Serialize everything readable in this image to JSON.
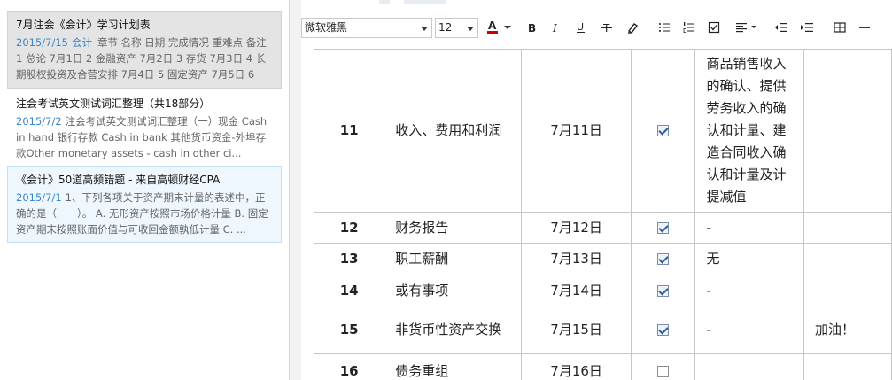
{
  "notes": [
    {
      "title": "7月注会《会计》学习计划表",
      "date": "2015/7/15",
      "tag": "会计",
      "snippet": "章节 名称 日期 完成情况 重难点 备注 1 总论 7月1日 2 金融资产 7月2日 3 存货 7月3日 4 长期股权投资及合营安排 7月4日 5 固定资产 7月5日 6"
    },
    {
      "title": "注会考试英文测试词汇整理（共18部分）",
      "date": "2015/7/2",
      "tag": "",
      "snippet": "注会考试英文测试词汇整理（一）现金 Cash in hand 银行存款 Cash in bank 其他货币资金-外埠存款Other monetary assets - cash in other ci..."
    },
    {
      "title": "《会计》50道高频错题 - 来自高顿财经CPA",
      "date": "2015/7/1",
      "tag": "",
      "snippet": "1、下列各项关于资产期末计量的表述中，正确的是（　　）。 A. 无形资产按照市场价格计量 B. 固定资产期末按照账面价值与可收回金额孰低计量 C. ..."
    }
  ],
  "toolbar": {
    "font_family": "微软雅黑",
    "font_size": "12",
    "buttons": [
      "font-color",
      "bold",
      "italic",
      "underline",
      "strikethrough",
      "highlight",
      "bulleted-list",
      "numbered-list",
      "checkbox",
      "align",
      "outdent",
      "indent",
      "table",
      "horizontal-rule"
    ],
    "font_color_accent": "#cc0000"
  },
  "table": {
    "rows": [
      {
        "num": "11",
        "name": "收入、费用和利润",
        "date": "7月11日",
        "checked": true,
        "key_points": "商品销售收入的确认、提供劳务收入的确认和计量、建造合同收入确认和计量及计提减值",
        "remark": ""
      },
      {
        "num": "12",
        "name": "财务报告",
        "date": "7月12日",
        "checked": true,
        "key_points": "-",
        "remark": ""
      },
      {
        "num": "13",
        "name": "职工薪酬",
        "date": "7月13日",
        "checked": true,
        "key_points": "无",
        "remark": ""
      },
      {
        "num": "14",
        "name": "或有事项",
        "date": "7月14日",
        "checked": true,
        "key_points": "-",
        "remark": ""
      },
      {
        "num": "15",
        "name": "非货币性资产交换",
        "date": "7月15日",
        "checked": true,
        "key_points": "-",
        "remark": "加油！"
      },
      {
        "num": "16",
        "name": "债务重组",
        "date": "7月16日",
        "checked": false,
        "key_points": "",
        "remark": ""
      }
    ]
  }
}
